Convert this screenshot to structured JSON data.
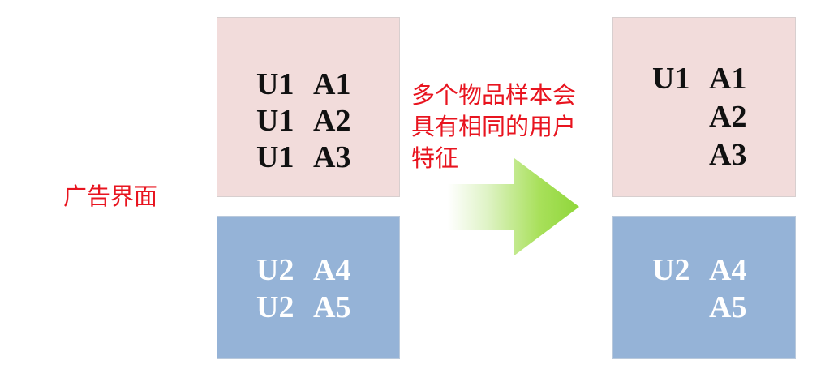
{
  "left_label": "广告界面",
  "note": {
    "lines": [
      "多个物品样本会",
      "具有相同的用户",
      "特征"
    ]
  },
  "left_pink": {
    "rows": [
      {
        "u": "U1",
        "a": "A1"
      },
      {
        "u": "U1",
        "a": "A2"
      },
      {
        "u": "U1",
        "a": "A3"
      }
    ]
  },
  "left_blue": {
    "rows": [
      {
        "u": "U2",
        "a": "A4"
      },
      {
        "u": "U2",
        "a": "A5"
      }
    ]
  },
  "right_pink": {
    "rows": [
      {
        "u": "U1",
        "a": "A1"
      },
      {
        "u": "",
        "a": "A2"
      },
      {
        "u": "",
        "a": "A3"
      }
    ]
  },
  "right_blue": {
    "rows": [
      {
        "u": "U2",
        "a": "A4"
      },
      {
        "u": "",
        "a": "A5"
      }
    ]
  },
  "colors": {
    "pink_box": "#f2dcdb",
    "blue_box": "#95b3d7",
    "red_text": "#e8141f",
    "arrow_green": "#8fd63a"
  }
}
